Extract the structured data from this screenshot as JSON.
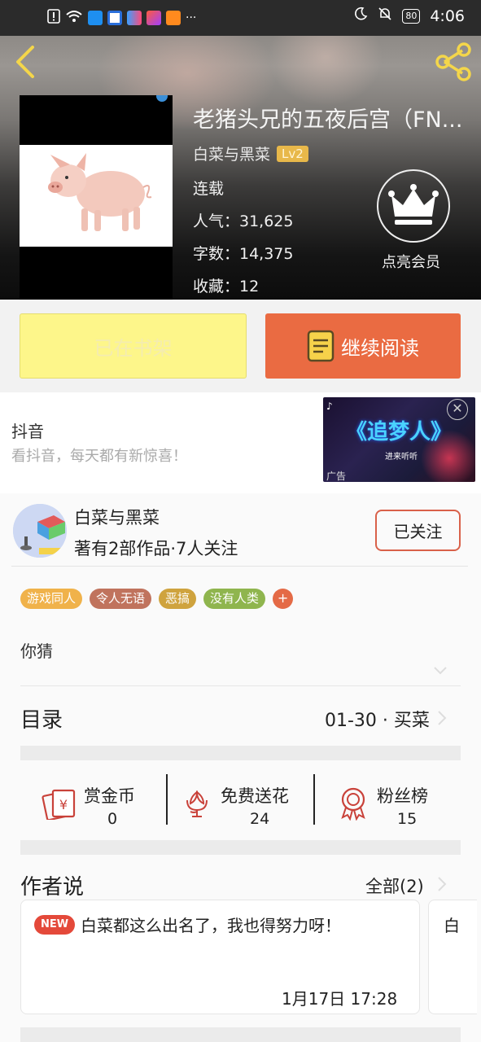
{
  "status_bar": {
    "time": "4:06",
    "battery": "80",
    "dots": "···"
  },
  "book": {
    "title": "老猪头兄的五夜后宫（FN...",
    "author": "白菜与黑菜",
    "level": "Lv2",
    "state": "连载",
    "popularity": "人气：31,625",
    "words": "字数：14,375",
    "favorites": "收藏：12",
    "vip_label": "点亮会员"
  },
  "actions": {
    "shelf_label": "已在书架",
    "read_label": "继续阅读"
  },
  "ad": {
    "title": "抖音",
    "subtitle": "看抖音，每天都有新惊喜！",
    "image_text": "《追梦人》",
    "image_subtext": "进来听听",
    "tag": "广告",
    "close": "✕"
  },
  "author_card": {
    "name": "白菜与黑菜",
    "meta": "著有2部作品·7人关注",
    "follow_label": "已关注"
  },
  "tags": [
    {
      "label": "游戏同人",
      "color": "#f0b24a"
    },
    {
      "label": "令人无语",
      "color": "#c0735d"
    },
    {
      "label": "恶搞",
      "color": "#cfa33e"
    },
    {
      "label": "没有人类",
      "color": "#8fb54e"
    }
  ],
  "tag_add": "+",
  "description": "你猜",
  "toc": {
    "title": "目录",
    "range": "01-30 · 买菜"
  },
  "stats": [
    {
      "label": "赏金币",
      "value": "0",
      "icon": "red-envelope-icon"
    },
    {
      "label": "免费送花",
      "value": "24",
      "icon": "flower-icon"
    },
    {
      "label": "粉丝榜",
      "value": "15",
      "icon": "medal-icon"
    }
  ],
  "author_says": {
    "title": "作者说",
    "all": "全部(2)",
    "new_badge": "NEW",
    "message": "白菜都这么出名了，我也得努力呀！",
    "date": "1月17日  17:28",
    "next_preview": "白"
  },
  "colors": {
    "accent": "#ea6b42",
    "shelf": "#fdf68a"
  }
}
